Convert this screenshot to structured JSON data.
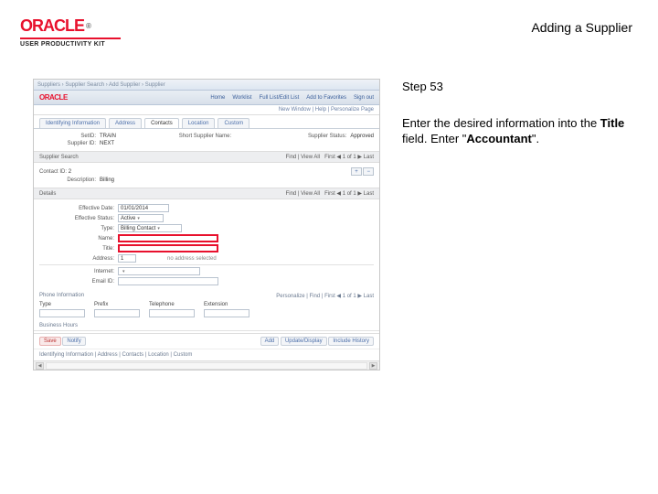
{
  "header": {
    "brand_top": "ORACLE",
    "brand_sub": "USER PRODUCTIVITY KIT",
    "page_title": "Adding a Supplier"
  },
  "instructions": {
    "step_label": "Step 53",
    "line1_pre": "Enter the desired information into the ",
    "line1_bold": "Title",
    "line1_post": " field. Enter \"",
    "line1_hl": "Accountant",
    "line1_end": "\"."
  },
  "shot": {
    "crumbs": "Suppliers  ›  Supplier Search  ›  Add Supplier  ›  Supplier",
    "logo": "ORACLE",
    "nav": [
      "Home",
      "Worklist",
      "Full List/Edit List",
      "Add to Favorites",
      "Sign out"
    ],
    "subbar": "New Window | Help | Personalize Page",
    "tabs": [
      "Identifying Information",
      "Address",
      "Contacts",
      "Location",
      "Custom"
    ],
    "active_tab_index": 2,
    "ident": {
      "setid_k": "SetID:",
      "setid_v": "TRAIN",
      "suppid_k": "Supplier ID:",
      "suppid_v": "NEXT",
      "shortname_k": "Short Supplier Name:",
      "status_k": "Supplier Status:",
      "status_v": "Approved"
    },
    "search": {
      "header": "Supplier Search",
      "contact_k": "Contact ID:",
      "contact_v": "2",
      "desc_k": "Description:",
      "desc_v": "Billing",
      "find_k": "Find | View All",
      "pager": "First ◀ 1 of 1 ▶ Last",
      "add_btn": "+",
      "del_btn": "−"
    },
    "details": {
      "header": "Details",
      "effdate_k": "Effective Date:",
      "effdate_v": "01/01/2014",
      "effstatus_k": "Effective Status:",
      "effstatus_v": "Active",
      "type_k": "Type:",
      "type_v": "Billing Contact",
      "name_k": "Name:",
      "title_k": "Title:",
      "address_k": "Address:",
      "address_v": "1",
      "internet_k": "Internet:",
      "internet_v": "",
      "emailid_k": "Email ID:",
      "noaddr": "no address selected",
      "find2": "Find | View All",
      "pager2": "First ◀ 1 of 1 ▶ Last"
    },
    "phone": {
      "header": "Phone Information",
      "find": "Personalize | Find | ",
      "pager": "First ◀ 1 of 1 ▶ Last",
      "cols": [
        "Type",
        "Prefix",
        "Telephone",
        "Extension"
      ]
    },
    "business": {
      "header": "Business Hours"
    },
    "footer": {
      "save": "Save",
      "notify": "Notify",
      "add": "Add",
      "update": "Update/Display",
      "include": "Include History"
    },
    "note": "Identifying Information | Address | Contacts | Location | Custom",
    "scroll_left": "◀",
    "scroll_right": "▶"
  }
}
